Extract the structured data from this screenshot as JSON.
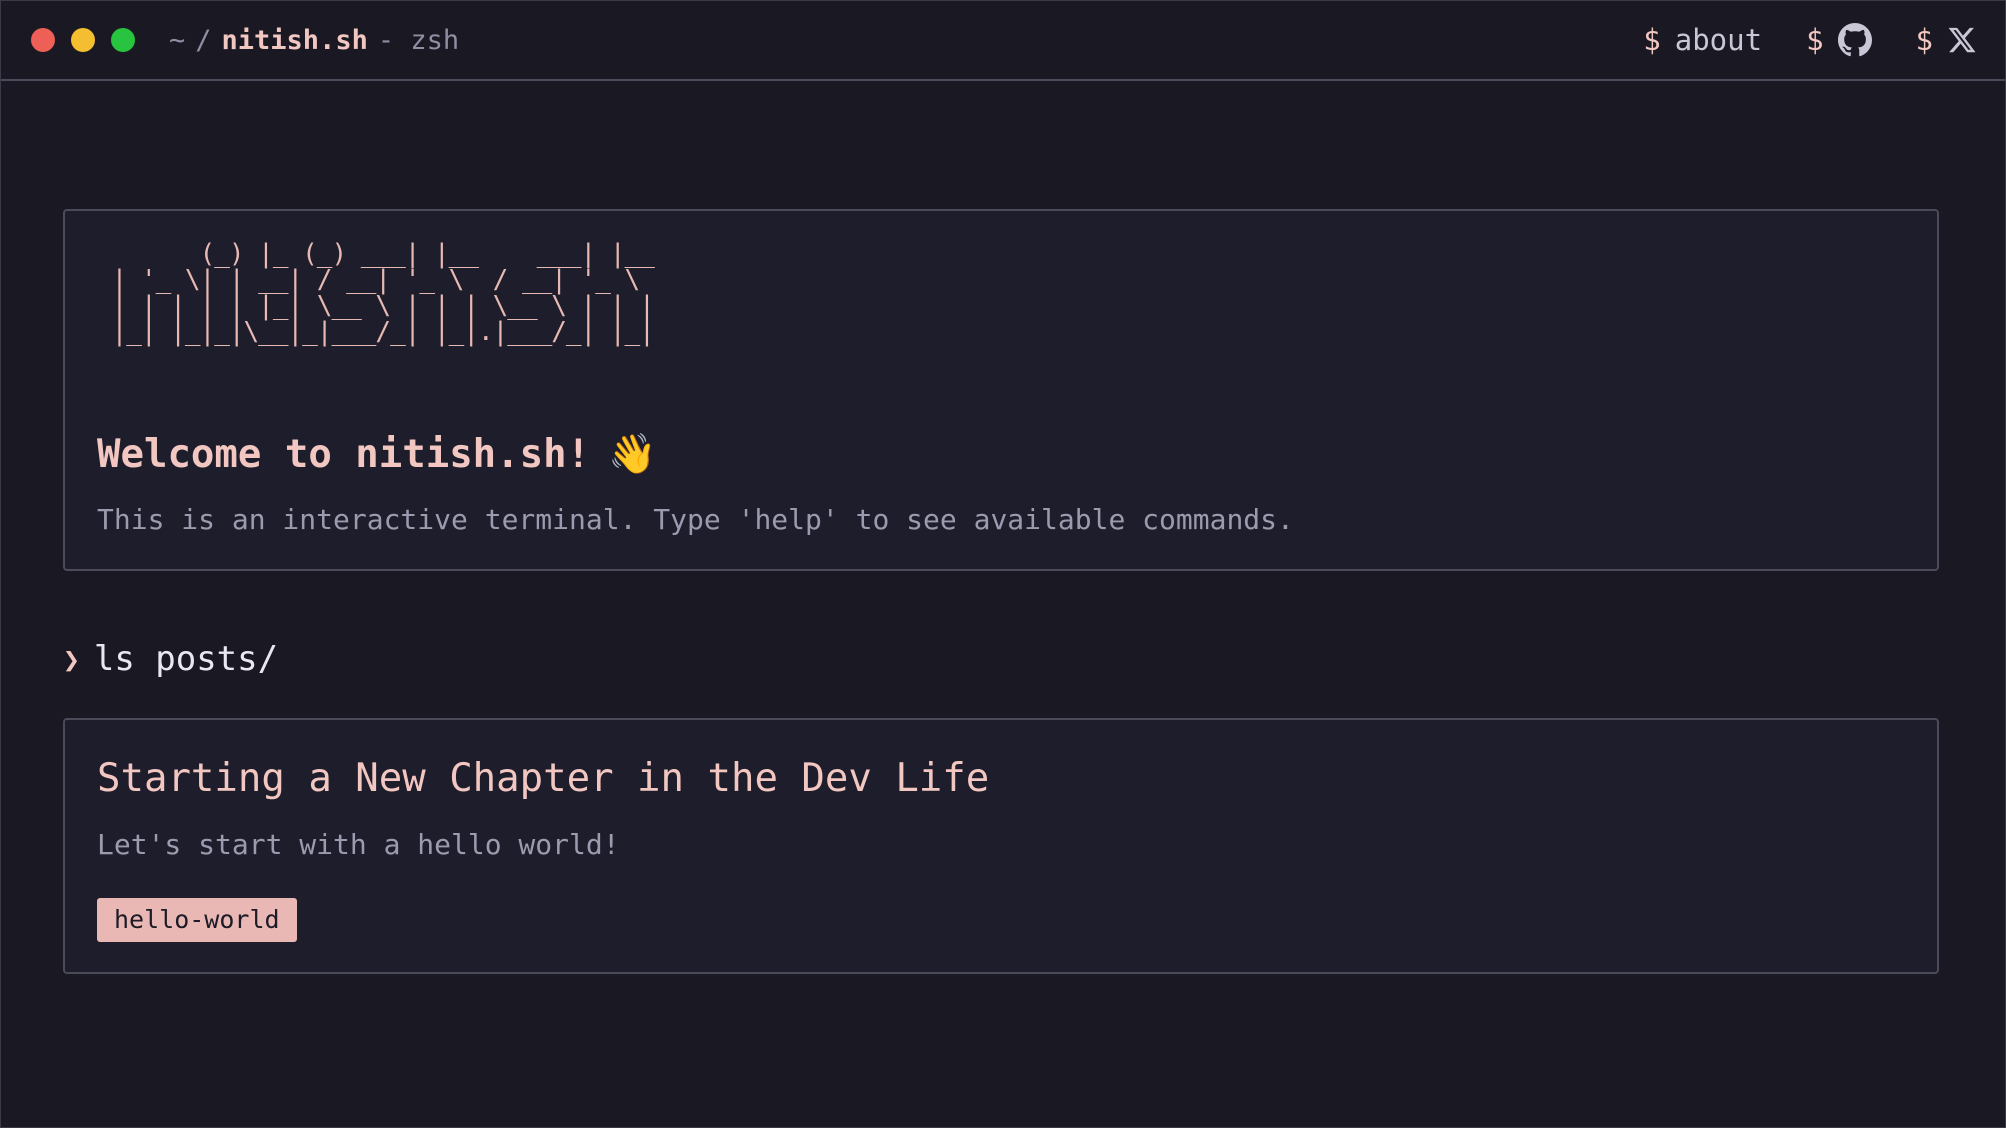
{
  "titlebar": {
    "path_home": "~",
    "path_sep": "/",
    "host": "nitish.sh",
    "shell": "- zsh"
  },
  "nav": {
    "items": [
      {
        "prompt": "$",
        "label": "about",
        "icon": ""
      },
      {
        "prompt": "$",
        "label": "",
        "icon": "github-icon"
      },
      {
        "prompt": "$",
        "label": "",
        "icon": "x-icon"
      }
    ]
  },
  "welcome": {
    "ascii_art": "       (_) |_ (_) ___| |__    ___| |__\n | '_ \\| | __| / __| '_ \\  / __| '_ \\\n | | | | | |_| \\__ \\ | | | \\__ \\ | | |\n |_| |_|_|\\__|_|___/_| |_|.|___/_| |_|",
    "title": "Welcome to nitish.sh!",
    "emoji": "👋",
    "description": "This is an interactive terminal. Type 'help' to see available commands."
  },
  "command": {
    "caret": "❯",
    "text": "ls posts/"
  },
  "posts": [
    {
      "title": "Starting a New Chapter in the Dev Life",
      "description": "Let's start with a hello world!",
      "tags": [
        "hello-world"
      ]
    }
  ],
  "colors": {
    "background": "#191823",
    "accent": "#f3c7c1",
    "tag_bg": "#eab8b4",
    "muted": "#9c9aae"
  }
}
